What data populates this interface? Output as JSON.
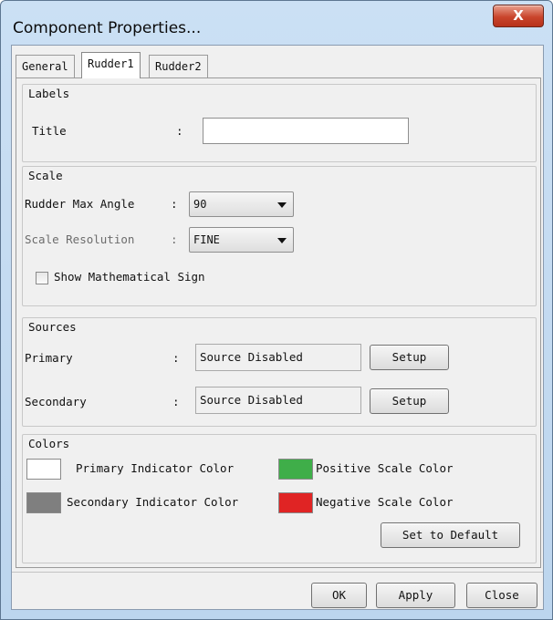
{
  "window": {
    "title": "Component Properties...",
    "close_label": "X"
  },
  "tabs": [
    {
      "label": "General",
      "active": false
    },
    {
      "label": "Rudder1",
      "active": true
    },
    {
      "label": "Rudder2",
      "active": false
    }
  ],
  "labels_group": {
    "title": "Labels",
    "title_label": "Title",
    "colon": ":",
    "title_value": ""
  },
  "scale_group": {
    "title": "Scale",
    "max_angle_label": "Rudder Max Angle",
    "max_angle_colon": ":",
    "max_angle_value": "90",
    "resolution_label": "Scale Resolution",
    "resolution_colon": ":",
    "resolution_value": "FINE",
    "math_sign_label": "Show Mathematical Sign",
    "math_sign_checked": false
  },
  "sources_group": {
    "title": "Sources",
    "primary_label": "Primary",
    "primary_colon": ":",
    "primary_value": "Source Disabled",
    "primary_setup": "Setup",
    "secondary_label": "Secondary",
    "secondary_colon": ":",
    "secondary_value": "Source Disabled",
    "secondary_setup": "Setup"
  },
  "colors_group": {
    "title": "Colors",
    "primary_indicator_label": "Primary Indicator Color",
    "primary_indicator_color": "#ffffff",
    "positive_scale_label": "Positive Scale Color",
    "positive_scale_color": "#3fae49",
    "secondary_indicator_label": "Secondary Indicator Color",
    "secondary_indicator_color": "#7f7f7f",
    "negative_scale_label": "Negative Scale Color",
    "negative_scale_color": "#e02424",
    "default_button": "Set to Default"
  },
  "footer": {
    "ok": "OK",
    "apply": "Apply",
    "close": "Close"
  }
}
